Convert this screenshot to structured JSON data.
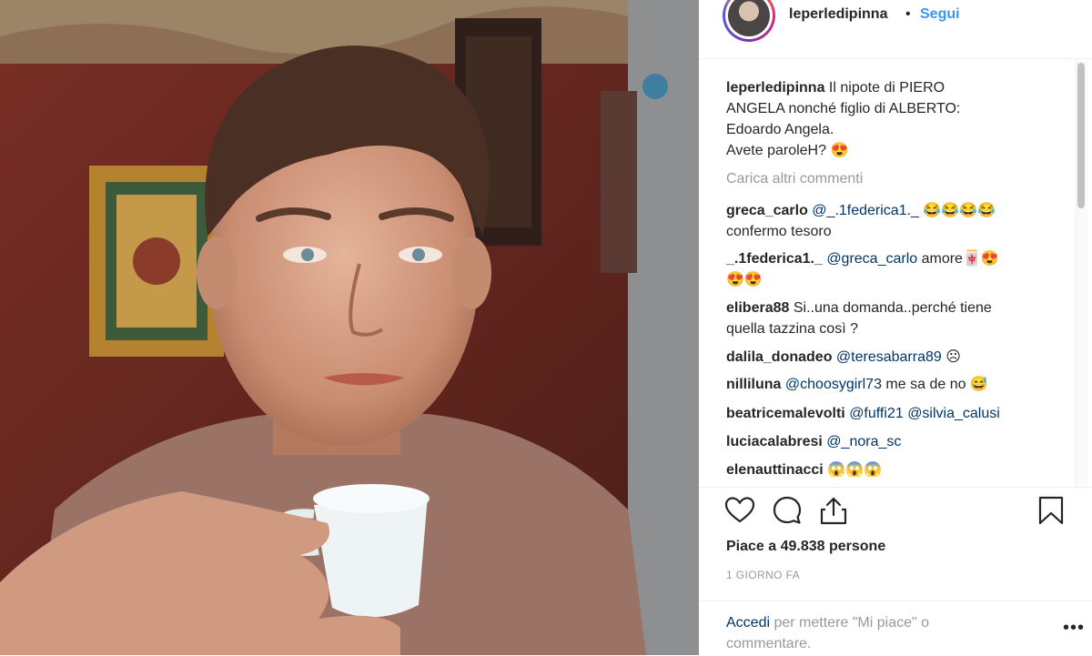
{
  "header": {
    "username": "leperledipinna",
    "separator": "•",
    "follow_label": "Segui"
  },
  "caption": {
    "username": "leperledipinna",
    "lines": [
      "Il nipote di PIERO",
      "ANGELA nonché figlio di ALBERTO:",
      "Edoardo Angela.",
      "Avete paroleH? 😍"
    ]
  },
  "load_more_label": "Carica altri commenti",
  "comments": [
    {
      "user": "greca_carlo",
      "mention": "@_.1federica1._",
      "text": " 😂😂😂😂",
      "line2": "confermo tesoro"
    },
    {
      "user": "_.1federica1._",
      "mention": "@greca_carlo",
      "text": " amore🀄😍",
      "line2": "😍😍"
    },
    {
      "user": "elibera88",
      "text": "Si..una domanda..perché tiene",
      "line2": "quella tazzina così ?"
    },
    {
      "user": "dalila_donadeo",
      "mention": "@teresabarra89",
      "text": " ☹"
    },
    {
      "user": "nilliluna",
      "mention": "@choosygirl73",
      "text": " me sa de no 😅"
    },
    {
      "user": "beatricemalevolti",
      "mention": "@fuffi21",
      "mention2": "@silvia_calusi"
    },
    {
      "user": "luciacalabresi",
      "mention": "@_nora_sc"
    },
    {
      "user": "elenauttinacci",
      "text": "😱😱😱"
    }
  ],
  "icons": {
    "like": "heart-icon",
    "comment": "comment-bubble-icon",
    "share": "share-icon",
    "save": "bookmark-icon",
    "more": "more-options-icon"
  },
  "likes_label": "Piace a 49.838 persone",
  "time_label": "1 GIORNO FA",
  "login_prompt": {
    "link": "Accedi",
    "text_line1": " per mettere \"Mi piace\" o",
    "text_line2": "commentare."
  },
  "more_label": "•••",
  "colors": {
    "link_blue": "#3897f0",
    "mention_blue": "#003569",
    "text_dark": "#262626",
    "muted_gray": "#999999"
  }
}
